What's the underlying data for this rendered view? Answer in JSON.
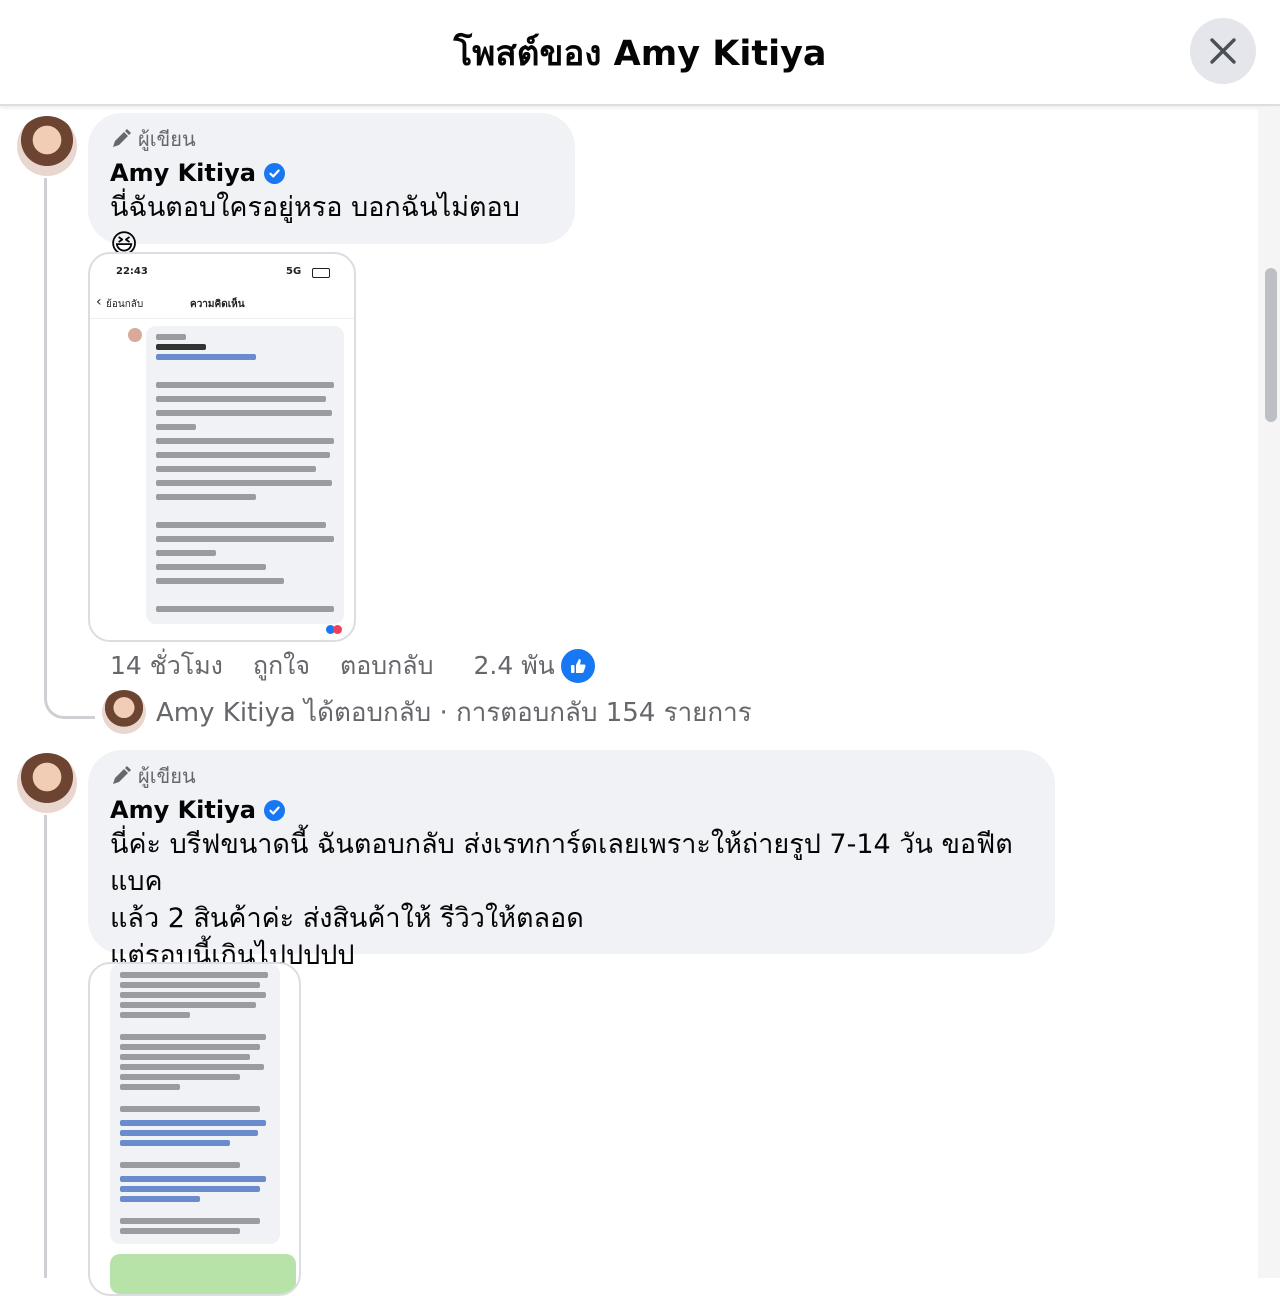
{
  "header": {
    "title": "โพสต์ของ Amy Kitiya"
  },
  "icons": {
    "close": "close-icon",
    "author_badge": "pencil-icon",
    "verified": "verified-badge-icon",
    "like": "like-icon"
  },
  "colors": {
    "accent": "#1877f2",
    "bubble": "#f0f2f5",
    "muted": "#65676b"
  },
  "comments": [
    {
      "badge": "ผู้เขียน",
      "author": "Amy Kitiya",
      "text": "นี่ฉันตอบใครอยู่หรอ บอกฉันไม่ตอบ 😆",
      "attachment": {
        "time": "22:43",
        "signal": "5G",
        "back": "ย้อนกลับ",
        "screen_title": "ความคิดเห็น"
      },
      "meta": {
        "time": "14 ชั่วโมง",
        "like": "ถูกใจ",
        "reply": "ตอบกลับ",
        "reactions": "2.4 พัน"
      },
      "replies": "Amy Kitiya ได้ตอบกลับ · การตอบกลับ 154 รายการ"
    },
    {
      "badge": "ผู้เขียน",
      "author": "Amy Kitiya",
      "text": "นี่ค่ะ บรีฟขนาดนี้ ฉันตอบกลับ ส่งเรทการ์ดเลยเพราะให้ถ่ายรูป 7-14 วัน ขอฟีตแบค\nแล้ว 2 สินค้าค่ะ ส่งสินค้าให้ รีวิวให้ตลอด\nแต่รอบนี้เกินไปปปปป"
    }
  ]
}
